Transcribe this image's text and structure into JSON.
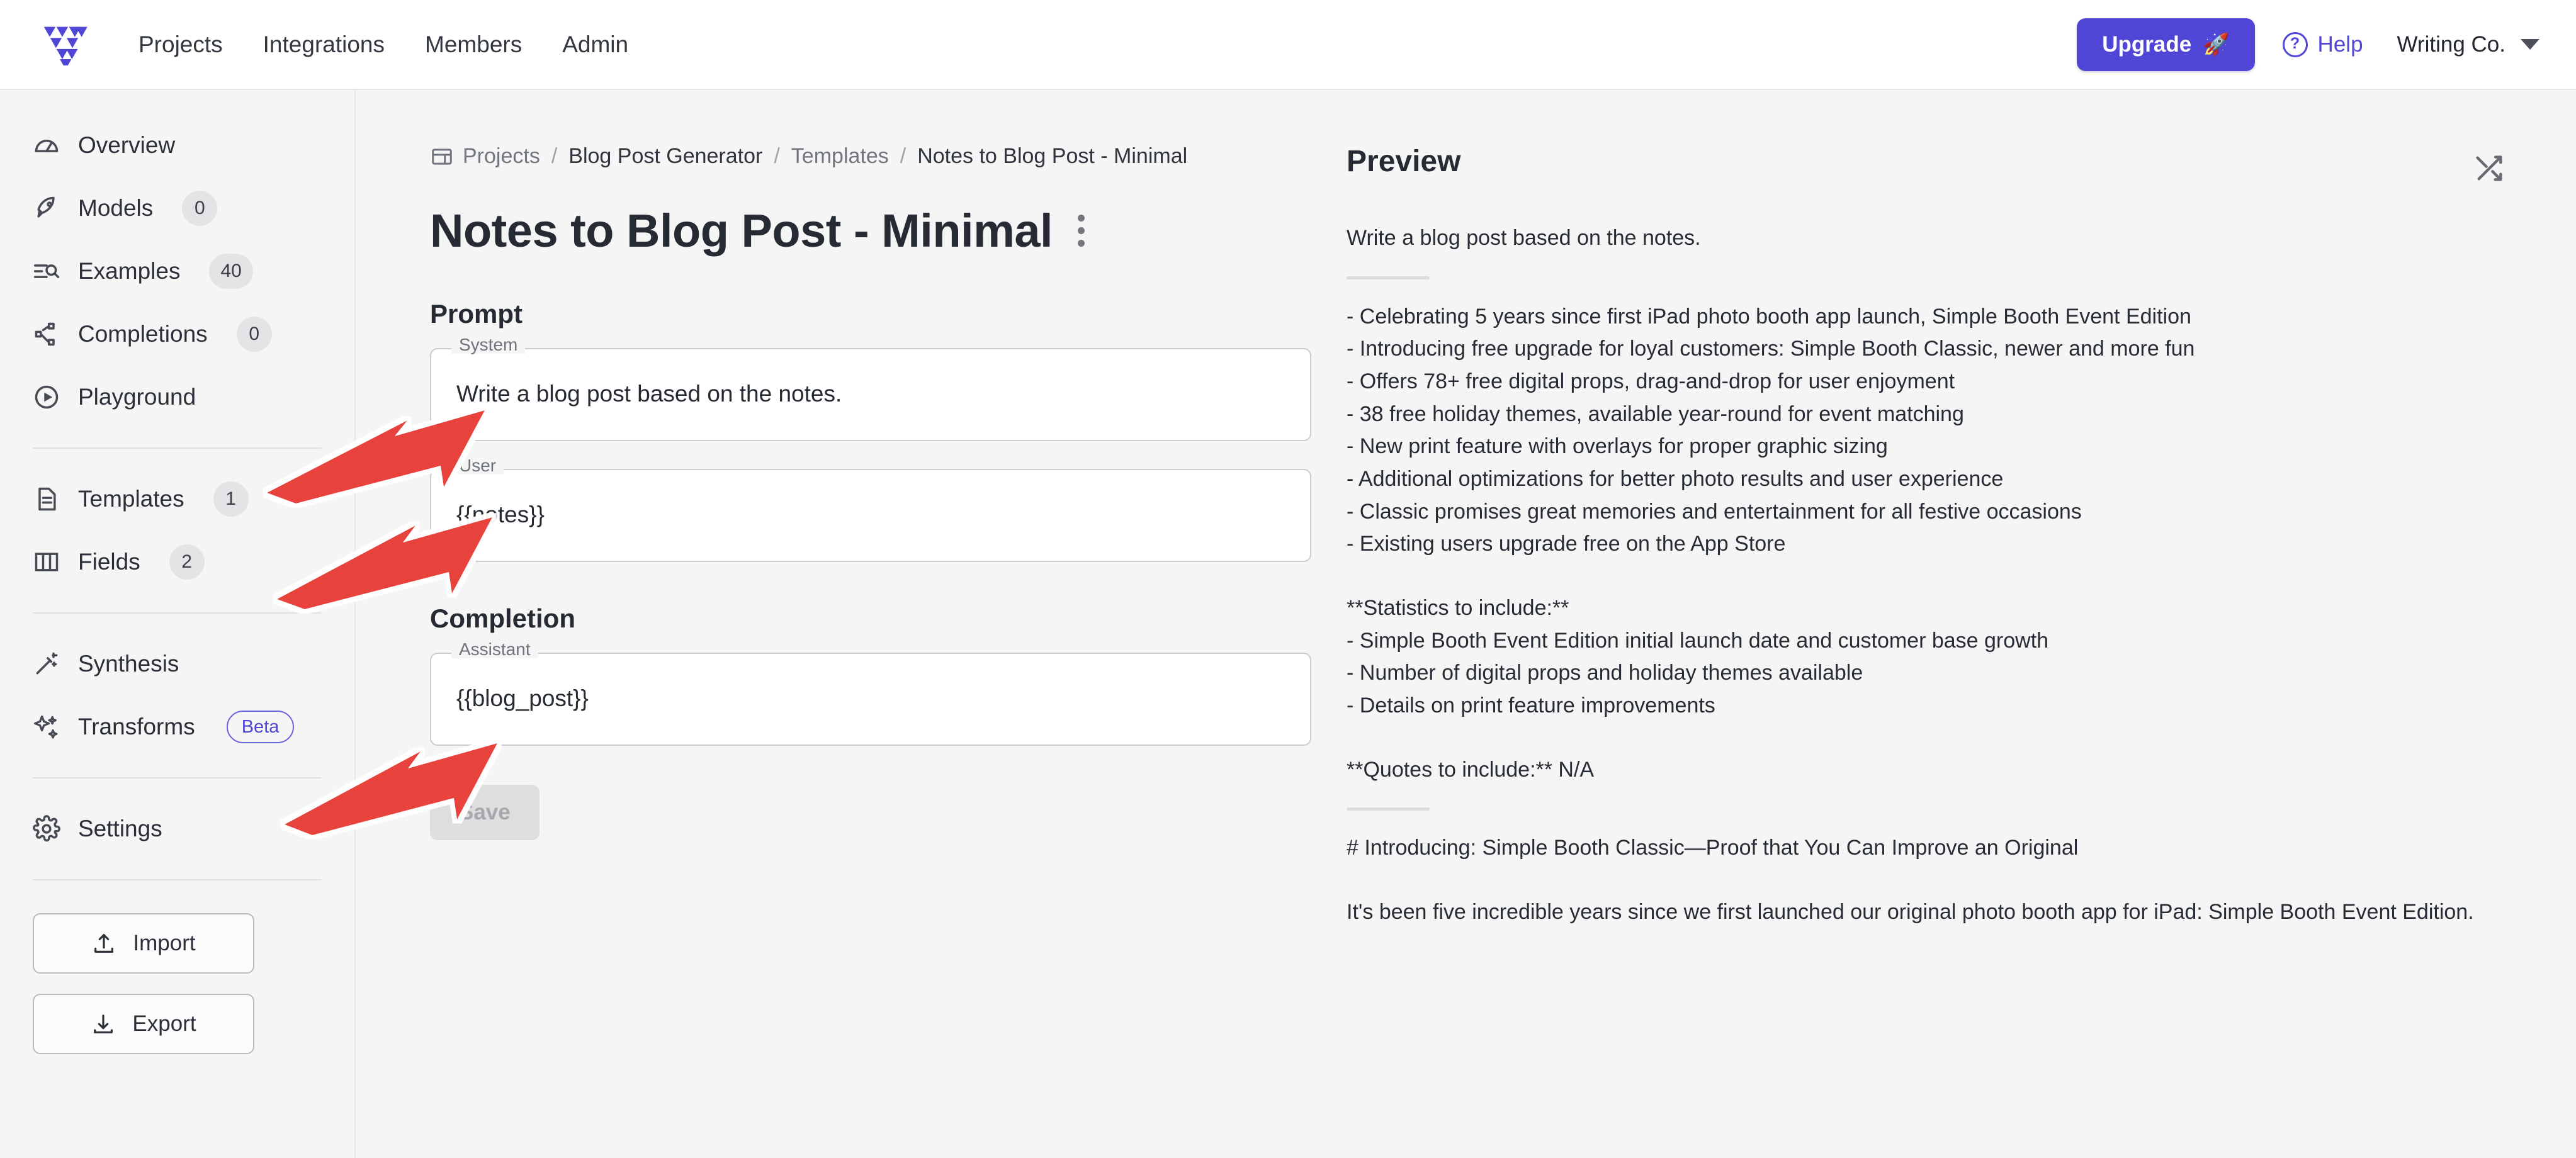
{
  "header": {
    "logo_name": "triangle-logo",
    "nav": [
      {
        "label": "Projects"
      },
      {
        "label": "Integrations"
      },
      {
        "label": "Members"
      },
      {
        "label": "Admin"
      }
    ],
    "upgrade_label": "Upgrade",
    "upgrade_icon": "rocket-icon",
    "upgrade_color": "#4f46d6",
    "help_label": "Help",
    "help_icon": "question-circle-icon",
    "account_label": "Writing Co.",
    "account_caret": "chevron-down-icon"
  },
  "sidebar": {
    "items": [
      {
        "label": "Overview",
        "icon": "gauge-icon",
        "badge": null
      },
      {
        "label": "Models",
        "icon": "rocket-icon",
        "badge": "0"
      },
      {
        "label": "Examples",
        "icon": "list-search-icon",
        "badge": "40"
      },
      {
        "label": "Completions",
        "icon": "share-nodes-icon",
        "badge": "0"
      },
      {
        "label": "Playground",
        "icon": "play-circle-icon",
        "badge": null
      },
      {
        "label": "Templates",
        "icon": "document-icon",
        "badge": "1"
      },
      {
        "label": "Fields",
        "icon": "columns-icon",
        "badge": "2"
      },
      {
        "label": "Synthesis",
        "icon": "magic-wand-icon",
        "badge": null
      },
      {
        "label": "Transforms",
        "icon": "sparkles-icon",
        "badge": "Beta"
      },
      {
        "label": "Settings",
        "icon": "gear-icon",
        "badge": null
      }
    ],
    "import_label": "Import",
    "export_label": "Export"
  },
  "breadcrumb": {
    "icon": "dashboard-icon",
    "items": [
      "Projects",
      "Blog Post Generator",
      "Templates",
      "Notes to Blog Post - Minimal"
    ],
    "separator": "/"
  },
  "page": {
    "title": "Notes to Blog Post - Minimal",
    "menu_icon": "kebab-menu-icon"
  },
  "prompt": {
    "heading": "Prompt",
    "system_label": "System",
    "system_value": "Write a blog post based on the notes.",
    "user_label": "User",
    "user_value": "{{notes}}"
  },
  "completion": {
    "heading": "Completion",
    "assistant_label": "Assistant",
    "assistant_value": "{{blog_post}}",
    "save_label": "Save"
  },
  "preview": {
    "title": "Preview",
    "shuffle_icon": "shuffle-icon",
    "lines": [
      {
        "type": "text",
        "value": "Write a blog post based on the notes."
      },
      {
        "type": "rule"
      },
      {
        "type": "text",
        "value": "- Celebrating 5 years since first iPad photo booth app launch, Simple Booth Event Edition"
      },
      {
        "type": "text",
        "value": "- Introducing free upgrade for loyal customers: Simple Booth Classic, newer and more fun"
      },
      {
        "type": "text",
        "value": "- Offers 78+ free digital props, drag-and-drop for user enjoyment"
      },
      {
        "type": "text",
        "value": "- 38 free holiday themes, available year-round for event matching"
      },
      {
        "type": "text",
        "value": "- New print feature with overlays for proper graphic sizing"
      },
      {
        "type": "text",
        "value": "- Additional optimizations for better photo results and user experience"
      },
      {
        "type": "text",
        "value": "- Classic promises great memories and entertainment for all festive occasions"
      },
      {
        "type": "text",
        "value": "- Existing users upgrade free on the App Store"
      },
      {
        "type": "blank"
      },
      {
        "type": "text",
        "value": "**Statistics to include:**"
      },
      {
        "type": "text",
        "value": "- Simple Booth Event Edition initial launch date and customer base growth"
      },
      {
        "type": "text",
        "value": "- Number of digital props and holiday themes available"
      },
      {
        "type": "text",
        "value": "- Details on print feature improvements"
      },
      {
        "type": "blank"
      },
      {
        "type": "text",
        "value": "**Quotes to include:** N/A"
      },
      {
        "type": "rule"
      },
      {
        "type": "text",
        "value": "# Introducing: Simple Booth Classic—Proof that You Can Improve an Original"
      },
      {
        "type": "blank"
      },
      {
        "type": "text",
        "value": "It's been five incredible years since we first launched our original photo booth app for iPad: Simple Booth Event Edition."
      }
    ]
  },
  "annotations": {
    "arrow_color": "#e8423c",
    "arrows": [
      {
        "name": "arrow-to-system-field",
        "target": "System"
      },
      {
        "name": "arrow-to-user-field",
        "target": "User"
      },
      {
        "name": "arrow-to-assistant-field",
        "target": "Assistant"
      }
    ]
  }
}
